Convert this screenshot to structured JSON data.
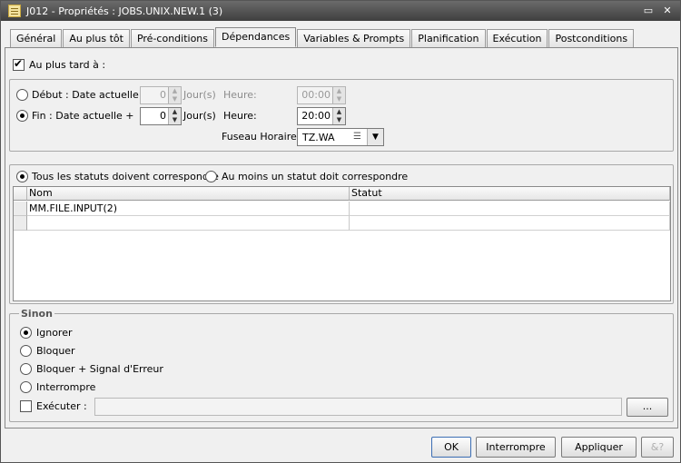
{
  "window": {
    "title": "J012 - Propriétés : JOBS.UNIX.NEW.1 (3)",
    "controls": {
      "restore": "▭",
      "close": "✕"
    }
  },
  "tabs": [
    {
      "label": "Général"
    },
    {
      "label": "Au plus tôt"
    },
    {
      "label": "Pré-conditions"
    },
    {
      "label": "Dépendances",
      "active": true
    },
    {
      "label": "Variables & Prompts"
    },
    {
      "label": "Planification"
    },
    {
      "label": "Exécution"
    },
    {
      "label": "Postconditions"
    }
  ],
  "latest": {
    "label": "Au plus tard à :",
    "checked": true,
    "start": {
      "label": "Début : Date actuelle +",
      "days": "0",
      "days_unit": "Jour(s)",
      "time_label": "Heure:",
      "time": "00:00"
    },
    "end": {
      "label": "Fin : Date actuelle +",
      "days": "0",
      "days_unit": "Jour(s)",
      "time_label": "Heure:",
      "time": "20:00"
    },
    "timezone_label": "Fuseau Horaire :",
    "timezone": "TZ.WA"
  },
  "status_match": {
    "all_label": "Tous les statuts doivent correspondre",
    "any_label": "Au moins un statut doit correspondre",
    "columns": [
      "Nom",
      "Statut"
    ],
    "rows": [
      [
        "MM.FILE.INPUT(2)",
        ""
      ],
      [
        "",
        ""
      ]
    ]
  },
  "else_group": {
    "title": "Sinon",
    "options": [
      {
        "label": "Ignorer",
        "selected": true
      },
      {
        "label": "Bloquer"
      },
      {
        "label": "Bloquer + Signal d'Erreur"
      },
      {
        "label": "Interrompre"
      }
    ],
    "execute_label": "Exécuter :",
    "execute_value": "",
    "browse_label": "..."
  },
  "footer": {
    "ok": "OK",
    "cancel": "Interrompre",
    "apply": "Appliquer"
  }
}
